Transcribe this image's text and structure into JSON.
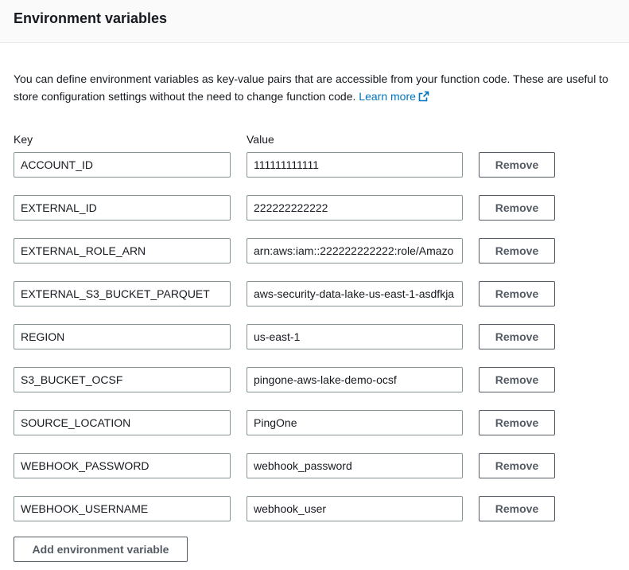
{
  "header": {
    "title": "Environment variables"
  },
  "description": {
    "text": "You can define environment variables as key-value pairs that are accessible from your function code. These are useful to store configuration settings without the need to change function code.",
    "link_label": "Learn more",
    "link_icon": "external-link-icon"
  },
  "columns": {
    "key_label": "Key",
    "value_label": "Value"
  },
  "variables": [
    {
      "key": "ACCOUNT_ID",
      "value": "111111111111",
      "remove_label": "Remove"
    },
    {
      "key": "EXTERNAL_ID",
      "value": "222222222222",
      "remove_label": "Remove"
    },
    {
      "key": "EXTERNAL_ROLE_ARN",
      "value": "arn:aws:iam::222222222222:role/Amazo",
      "remove_label": "Remove"
    },
    {
      "key": "EXTERNAL_S3_BUCKET_PARQUET",
      "value": "aws-security-data-lake-us-east-1-asdfkja",
      "remove_label": "Remove"
    },
    {
      "key": "REGION",
      "value": "us-east-1",
      "remove_label": "Remove"
    },
    {
      "key": "S3_BUCKET_OCSF",
      "value": "pingone-aws-lake-demo-ocsf",
      "remove_label": "Remove"
    },
    {
      "key": "SOURCE_LOCATION",
      "value": "PingOne",
      "remove_label": "Remove"
    },
    {
      "key": "WEBHOOK_PASSWORD",
      "value": "webhook_password",
      "remove_label": "Remove"
    },
    {
      "key": "WEBHOOK_USERNAME",
      "value": "webhook_user",
      "remove_label": "Remove"
    }
  ],
  "actions": {
    "add_label": "Add environment variable"
  },
  "colors": {
    "link": "#0073bb",
    "button_border": "#545b64",
    "input_border": "#879596",
    "header_bg": "#fafafa"
  }
}
